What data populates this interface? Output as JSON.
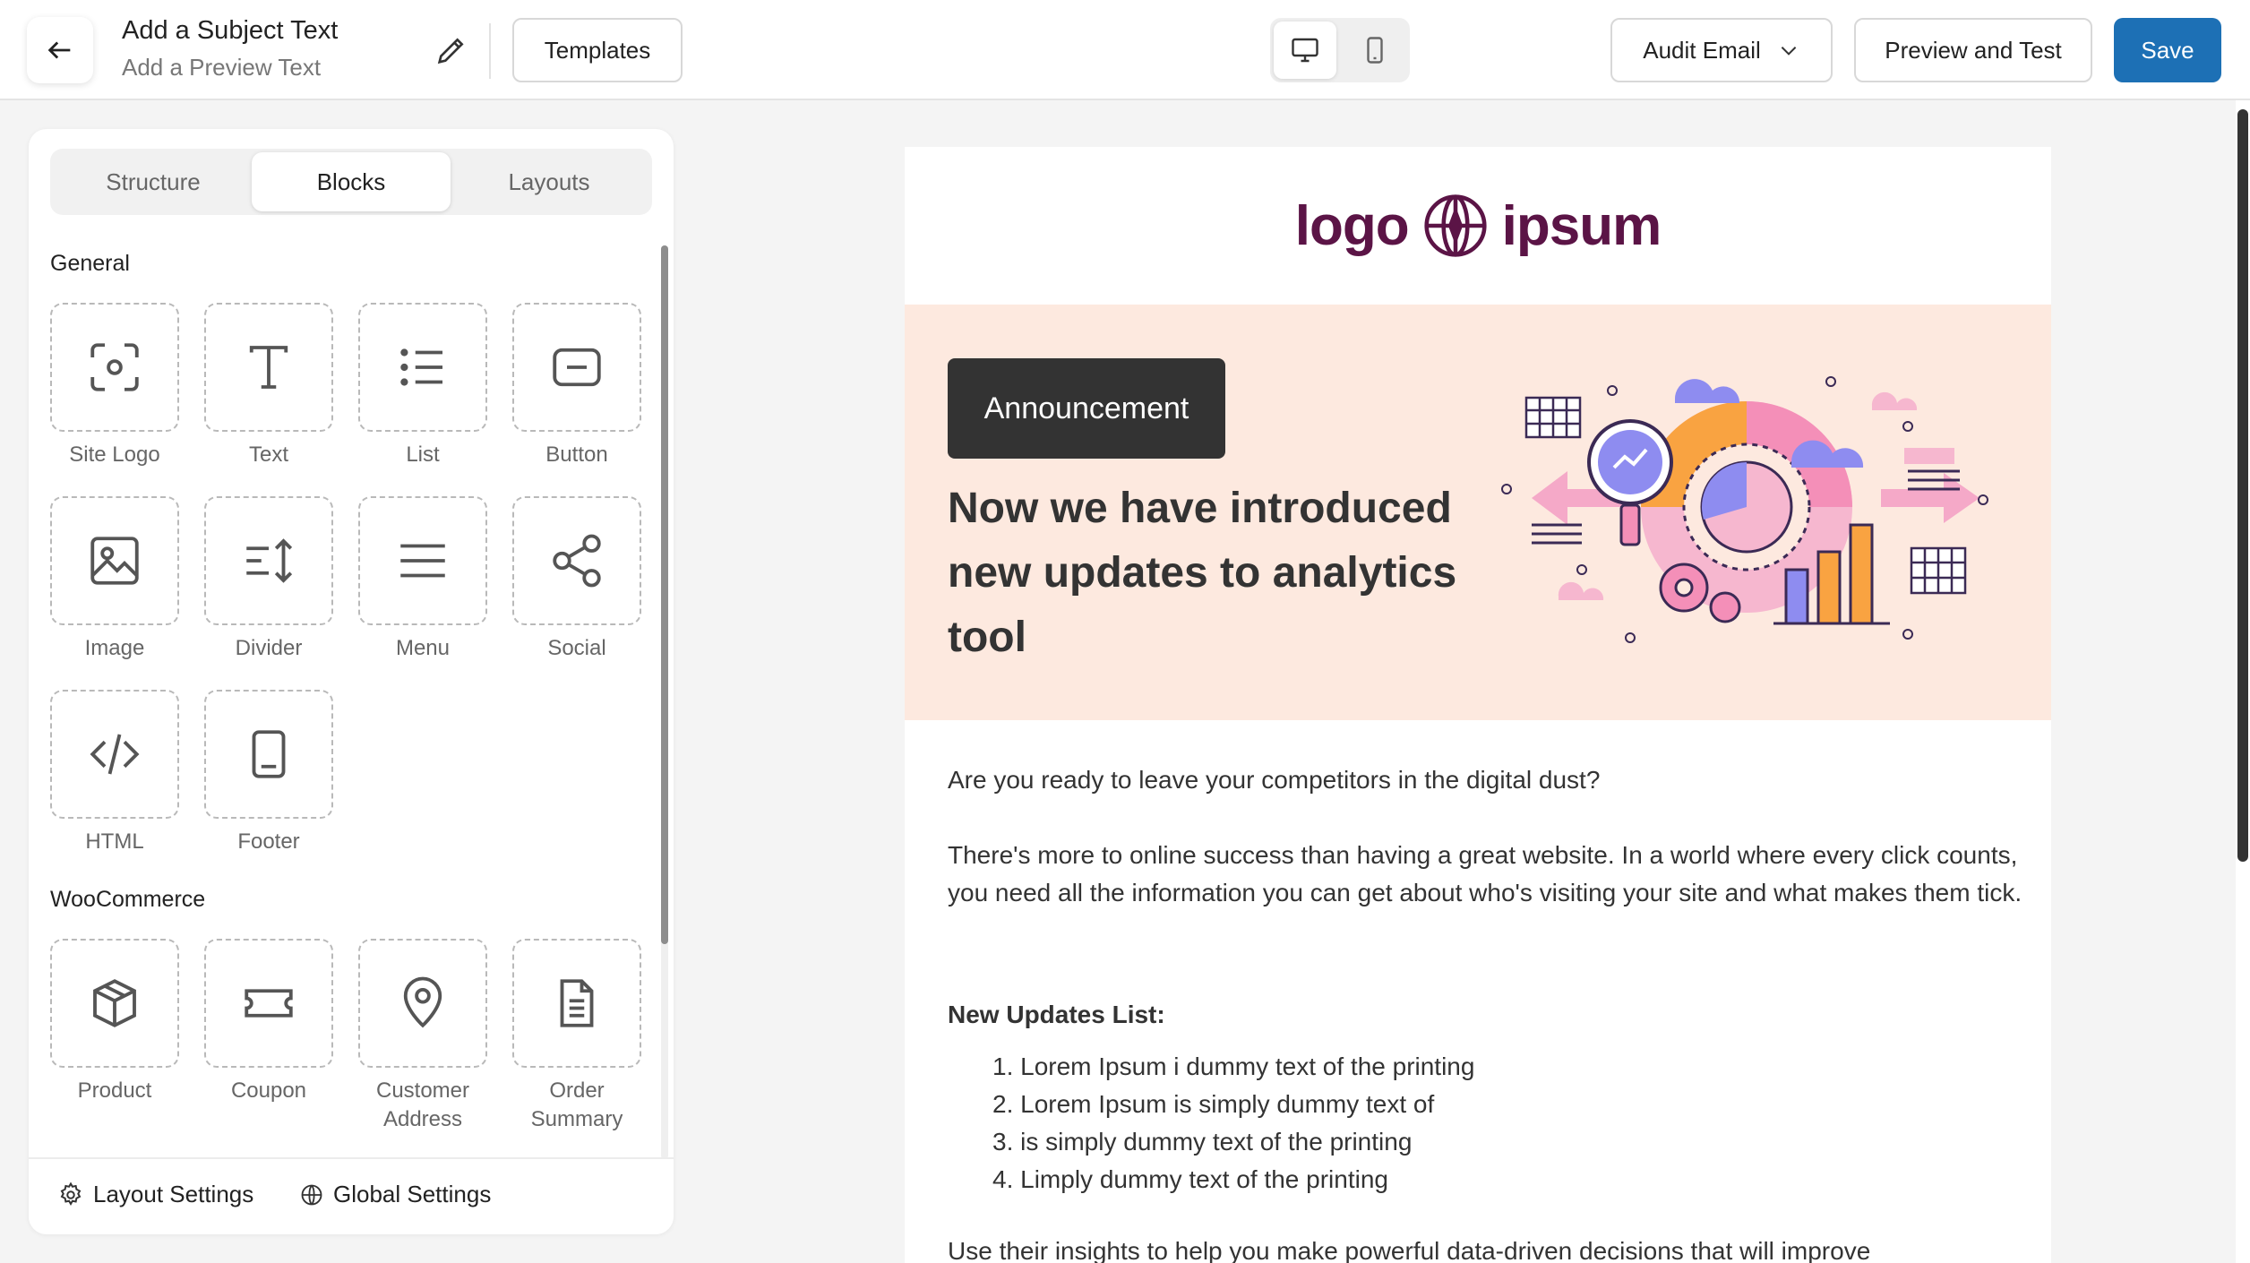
{
  "header": {
    "subject": "Add a Subject Text",
    "preview_text": "Add a Preview Text",
    "templates_label": "Templates",
    "audit_label": "Audit Email",
    "preview_test_label": "Preview and Test",
    "save_label": "Save"
  },
  "sidebar": {
    "tabs": [
      "Structure",
      "Blocks",
      "Layouts"
    ],
    "active_tab": "Blocks",
    "general_title": "General",
    "general_blocks": [
      "Site Logo",
      "Text",
      "List",
      "Button",
      "Image",
      "Divider",
      "Menu",
      "Social",
      "HTML",
      "Footer"
    ],
    "woo_title": "WooCommerce",
    "woo_blocks": [
      "Product",
      "Coupon",
      "Customer",
      "Address",
      "Order",
      "Summary"
    ],
    "footer": {
      "layout_settings": "Layout Settings",
      "global_settings": "Global Settings"
    }
  },
  "email": {
    "logo_left": "logo",
    "logo_right": "ipsum",
    "badge": "Announcement",
    "headline": "Now we have introduced new updates to analytics tool",
    "para1": "Are you ready to leave your competitors in the digital dust?",
    "para2": "There's more to online success than having a great website. In a world where every click counts, you need all the information you can get about who's visiting your site and what makes them tick.",
    "list_title": "New Updates List:",
    "list_items": [
      "1. Lorem Ipsum i dummy text of the printing",
      "2. Lorem Ipsum is simply dummy text of",
      "3. is simply dummy text of the printing",
      "4. Limply dummy text of the printing"
    ],
    "para3": "Use their insights to help you make powerful data-driven decisions that will improve"
  },
  "colors": {
    "accent": "#1d70b5",
    "logo": "#5b1446",
    "hero_bg": "#fde9df"
  }
}
